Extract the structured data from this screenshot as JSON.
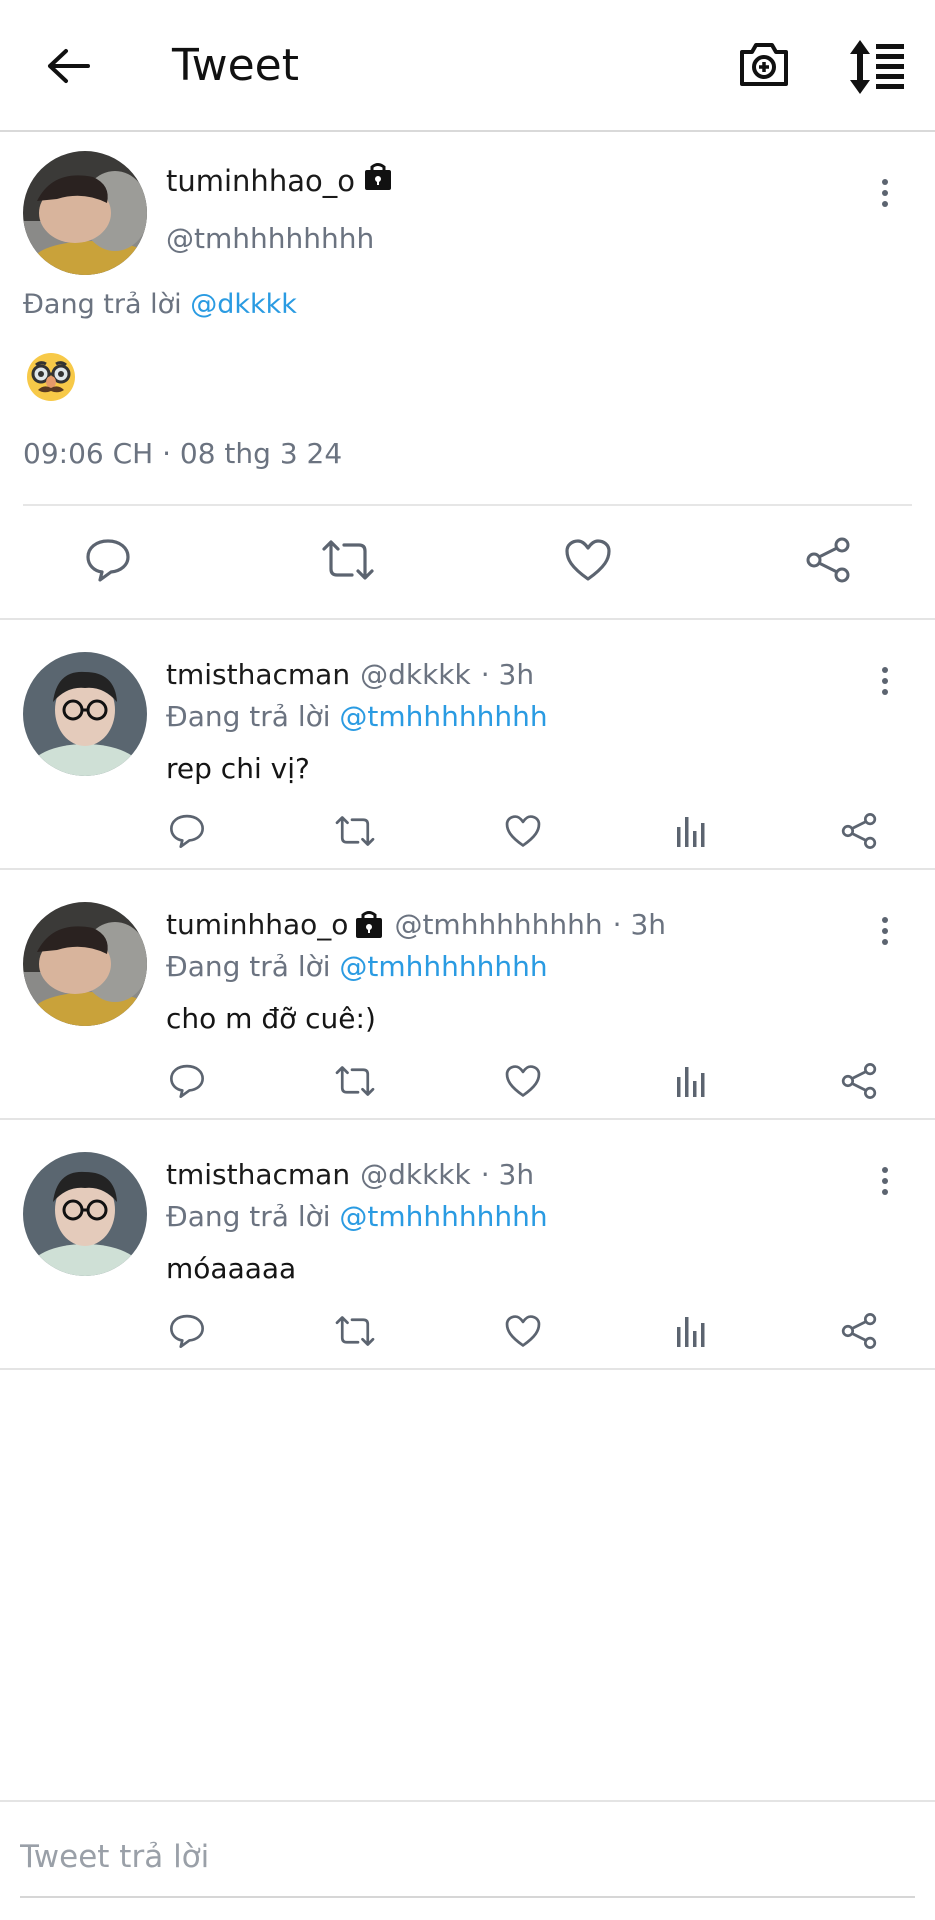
{
  "header": {
    "title": "Tweet",
    "back_icon": "back-arrow-icon",
    "camera_icon": "camera-add-icon",
    "sort_icon": "sort-icon"
  },
  "main_tweet": {
    "display_name": "tuminhhao_o",
    "handle": "@tmhhhhhhhh",
    "replying_label": "Đang trả lời",
    "replying_to": "@dkkkk",
    "emoji": "🥸",
    "timestamp": "09:06 CH · 08 thg 3 24",
    "actions": [
      "reply-icon",
      "retweet-icon",
      "like-icon",
      "share-icon"
    ]
  },
  "replies": [
    {
      "display_name": "tmisthacman",
      "handle": "@dkkkk",
      "time": "· 3h",
      "locked": false,
      "replying_label": "Đang trả lời",
      "replying_to": "@tmhhhhhhhh",
      "text": "rep chi vị?"
    },
    {
      "display_name": "tuminhhao_o",
      "handle": "@tmhhhhhhhh",
      "time": "· 3h",
      "locked": true,
      "replying_label": "Đang trả lời",
      "replying_to": "@tmhhhhhhhh",
      "text": "cho m đỡ cuê:)"
    },
    {
      "display_name": "tmisthacman",
      "handle": "@dkkkk",
      "time": "· 3h",
      "locked": false,
      "replying_label": "Đang trả lời",
      "replying_to": "@tmhhhhhhhh",
      "text": "móaaaaa"
    }
  ],
  "compose": {
    "placeholder": "Tweet trả lời"
  },
  "colors": {
    "accent": "#2a9be2",
    "muted": "#6b7380",
    "icon": "#5c6470"
  }
}
